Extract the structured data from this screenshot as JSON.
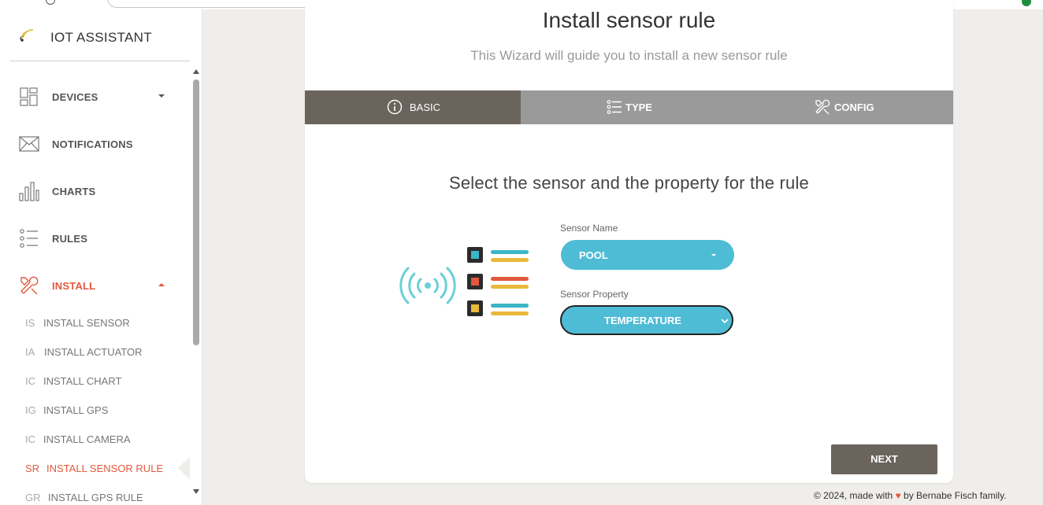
{
  "brand": {
    "name": "IOT ASSISTANT"
  },
  "sidebar": {
    "items": [
      {
        "label": "DEVICES",
        "icon": "dashboard-icon"
      },
      {
        "label": "NOTIFICATIONS",
        "icon": "mail-icon"
      },
      {
        "label": "CHARTS",
        "icon": "bar-chart-icon"
      },
      {
        "label": "RULES",
        "icon": "list-icon"
      },
      {
        "label": "INSTALL",
        "icon": "tools-icon"
      }
    ],
    "install_sub": [
      {
        "abbr": "IS",
        "label": "INSTALL SENSOR"
      },
      {
        "abbr": "IA",
        "label": "INSTALL ACTUATOR"
      },
      {
        "abbr": "IC",
        "label": "INSTALL CHART"
      },
      {
        "abbr": "IG",
        "label": "INSTALL GPS"
      },
      {
        "abbr": "IC",
        "label": "INSTALL CAMERA"
      },
      {
        "abbr": "SR",
        "label": "INSTALL SENSOR RULE"
      },
      {
        "abbr": "GR",
        "label": "INSTALL GPS RULE"
      }
    ]
  },
  "main": {
    "title": "Install sensor rule",
    "subtitle": "This Wizard will guide you to install a new sensor rule",
    "tabs": [
      {
        "label": "BASIC",
        "icon": "info-icon"
      },
      {
        "label": "TYPE",
        "icon": "list-icon"
      },
      {
        "label": "CONFIG",
        "icon": "tools-icon"
      }
    ],
    "prompt": "Select the sensor and the property for the rule",
    "sensor_name": {
      "label": "Sensor Name",
      "value": "POOL"
    },
    "sensor_property": {
      "label": "Sensor Property",
      "value": "TEMPERATURE"
    },
    "next_label": "NEXT"
  },
  "footer": {
    "prefix": "© 2024, made with",
    "suffix": "by Bernabe Fisch family.",
    "heart": "♥"
  },
  "colors": {
    "accent": "#e2583e",
    "tab_active": "#6b645d",
    "tab_inactive": "#9a9a9a",
    "select": "#4fbcd6"
  }
}
